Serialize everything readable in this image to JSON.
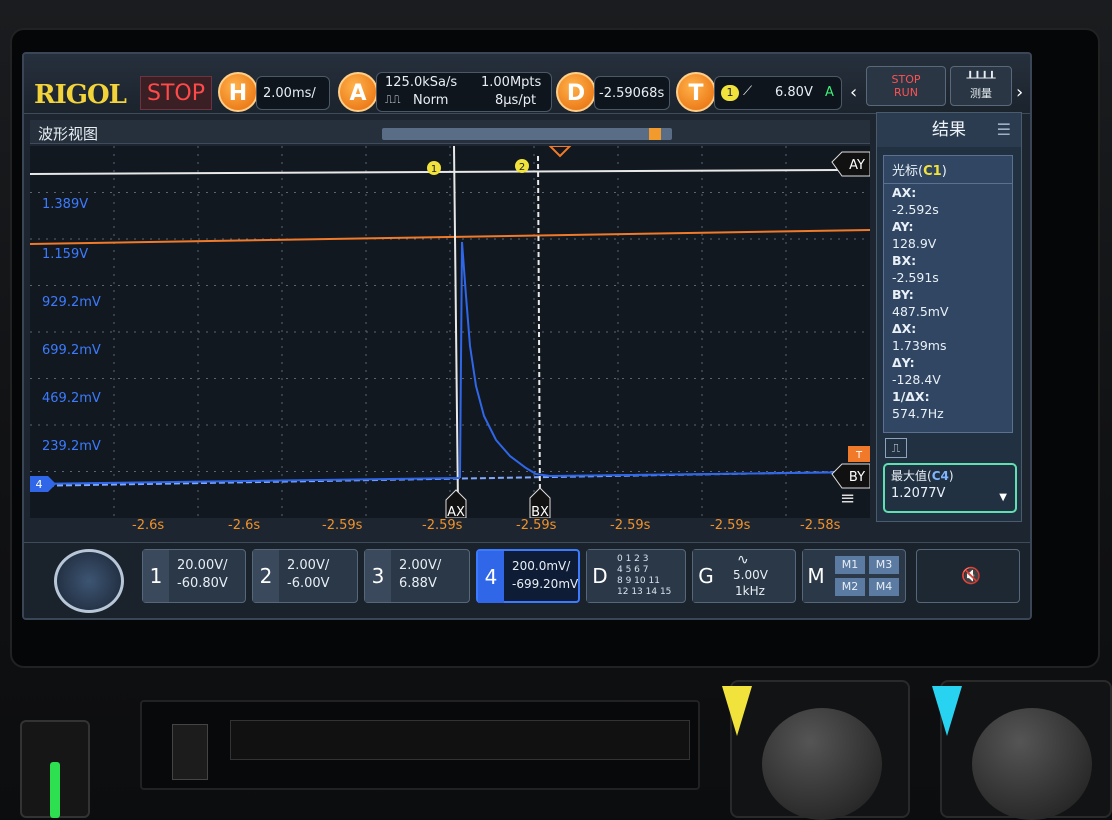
{
  "topbar": {
    "logo": "RIGOL",
    "status": "STOP",
    "horizontal": {
      "key": "H",
      "timebase": "2.00ms/"
    },
    "acquire": {
      "key": "A",
      "sample_rate": "125.0kSa/s",
      "mode": "Norm",
      "memory_depth": "1.00Mpts",
      "time_per_point": "8μs/pt"
    },
    "delay": {
      "key": "D",
      "value": "-2.59068s"
    },
    "trigger": {
      "key": "T",
      "channel": "1",
      "level": "6.80V",
      "mode": "A"
    },
    "run_stop_button": {
      "line1": "STOP",
      "line2": "RUN"
    },
    "measure_button": {
      "label": "测量"
    }
  },
  "waveform": {
    "title": "波形视图",
    "cursor_labels": {
      "ay": "AY",
      "by": "BY",
      "ax": "AX",
      "bx": "BX"
    },
    "markers": [
      "1",
      "2"
    ],
    "y_labels": [
      "1.389V",
      "1.159V",
      "929.2mV",
      "699.2mV",
      "469.2mV",
      "239.2mV"
    ],
    "channel_marker": "4",
    "x_labels": [
      "-2.6s",
      "-2.6s",
      "-2.59s",
      "-2.59s",
      "-2.59s",
      "-2.59s",
      "-2.59s",
      "-2.59s",
      "-2.58s"
    ],
    "trigger_marker": "T",
    "progress_fraction": 0.96
  },
  "results": {
    "title": "结果",
    "cursor_title": "光标",
    "cursor_channel": "C1",
    "items": [
      {
        "k": "AX:",
        "v": "-2.592s"
      },
      {
        "k": "AY:",
        "v": "128.9V"
      },
      {
        "k": "BX:",
        "v": "-2.591s"
      },
      {
        "k": "BY:",
        "v": "487.5mV"
      },
      {
        "k": "ΔX:",
        "v": "1.739ms"
      },
      {
        "k": "ΔY:",
        "v": "-128.4V"
      },
      {
        "k": "1/ΔX:",
        "v": "574.7Hz"
      }
    ],
    "max_label": "最大值",
    "max_channel": "C4",
    "max_value": "1.2077V"
  },
  "channels": [
    {
      "n": "1",
      "scale": "20.00V/",
      "offset": "-60.80V"
    },
    {
      "n": "2",
      "scale": "2.00V/",
      "offset": "-6.00V"
    },
    {
      "n": "3",
      "scale": "2.00V/",
      "offset": "6.88V"
    },
    {
      "n": "4",
      "scale": "200.0mV/",
      "offset": "-699.20mV"
    }
  ],
  "digital": {
    "key": "D",
    "rows": [
      "0 1 2 3",
      "4 5 6 7",
      "8 9 10 11",
      "12 13 14 15"
    ]
  },
  "generator": {
    "key": "G",
    "amplitude": "5.00V",
    "frequency": "1kHz"
  },
  "math": {
    "key": "M",
    "items": [
      "M1",
      "M3",
      "M2",
      "M4"
    ]
  },
  "colors": {
    "ch1": "#f1e23c",
    "ch2": "#27d3f0",
    "ch4": "#3c7bff",
    "trigger": "#f28a2a",
    "accent": "#f39a2c"
  }
}
